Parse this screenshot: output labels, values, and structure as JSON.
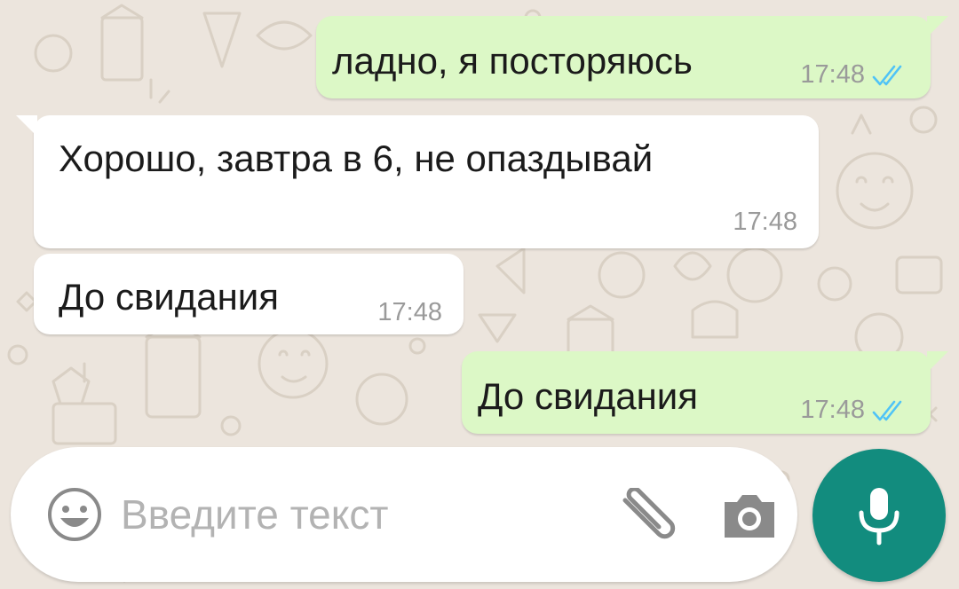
{
  "messages": [
    {
      "direction": "outgoing",
      "text": "ладно, я посторяюсь",
      "time": "17:48",
      "status_icon": "double-check-read-icon"
    },
    {
      "direction": "incoming",
      "text": "Хорошо, завтра в 6, не опаздывай",
      "time": "17:48"
    },
    {
      "direction": "incoming",
      "text": "До свидания",
      "time": "17:48"
    },
    {
      "direction": "outgoing",
      "text": "До свидания",
      "time": "17:48",
      "status_icon": "double-check-read-icon"
    }
  ],
  "composer": {
    "placeholder": "Введите текст",
    "value": "",
    "emoji_icon": "smiley-icon",
    "attach_icon": "paperclip-icon",
    "camera_icon": "camera-icon",
    "mic_icon": "microphone-icon"
  },
  "colors": {
    "wallpaper": "#ece5dd",
    "outgoing_bubble": "#dcf8c6",
    "incoming_bubble": "#ffffff",
    "read_ticks": "#4fc3f7",
    "mic_button": "#128c7e",
    "icons": "#8a8a8a"
  }
}
